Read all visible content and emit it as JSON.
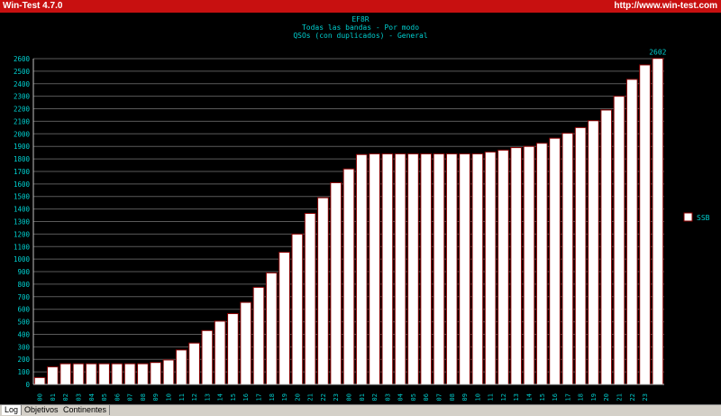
{
  "window": {
    "title": "Win-Test 4.7.0",
    "url": "http://www.win-test.com"
  },
  "tabs": [
    {
      "label": "Log"
    },
    {
      "label": "Objetivos"
    },
    {
      "label": "Continentes"
    }
  ],
  "chart_data": {
    "type": "bar",
    "title": "EF8R",
    "subtitle": [
      "Todas las bandas - Por modo",
      "QSOs (con duplicados) - General"
    ],
    "categories": [
      "00",
      "01",
      "02",
      "03",
      "04",
      "05",
      "06",
      "07",
      "08",
      "09",
      "10",
      "11",
      "12",
      "13",
      "14",
      "15",
      "16",
      "17",
      "18",
      "19",
      "20",
      "21",
      "22",
      "23",
      "00",
      "01",
      "02",
      "03",
      "04",
      "05",
      "06",
      "07",
      "08",
      "09",
      "10",
      "11",
      "12",
      "13",
      "14",
      "15",
      "16",
      "17",
      "18",
      "19",
      "20",
      "21",
      "22",
      "23"
    ],
    "series": [
      {
        "name": "SSB",
        "values": [
          55,
          140,
          165,
          165,
          165,
          165,
          165,
          165,
          165,
          175,
          195,
          275,
          330,
          430,
          505,
          565,
          655,
          775,
          890,
          1055,
          1200,
          1365,
          1490,
          1610,
          1720,
          1835,
          1840,
          1840,
          1840,
          1840,
          1840,
          1840,
          1840,
          1840,
          1840,
          1855,
          1870,
          1890,
          1900,
          1925,
          1965,
          2005,
          2050,
          2105,
          2190,
          2300,
          2435,
          2550,
          2602
        ]
      }
    ],
    "ylim": [
      0,
      2600
    ],
    "ytick_step": 100,
    "yticks": [
      0,
      100,
      200,
      300,
      400,
      500,
      600,
      700,
      800,
      900,
      1000,
      1100,
      1200,
      1300,
      1400,
      1500,
      1600,
      1700,
      1800,
      1900,
      2000,
      2100,
      2200,
      2300,
      2400,
      2500,
      2600
    ],
    "data_label": "2602",
    "grid": true,
    "legend": "right",
    "colors": {
      "bar_fill": "#ffffff",
      "bar_edge": "#8b0000",
      "text": "#00d0d0",
      "grid": "#5a5a5a",
      "axis": "#c0c0c0"
    }
  }
}
